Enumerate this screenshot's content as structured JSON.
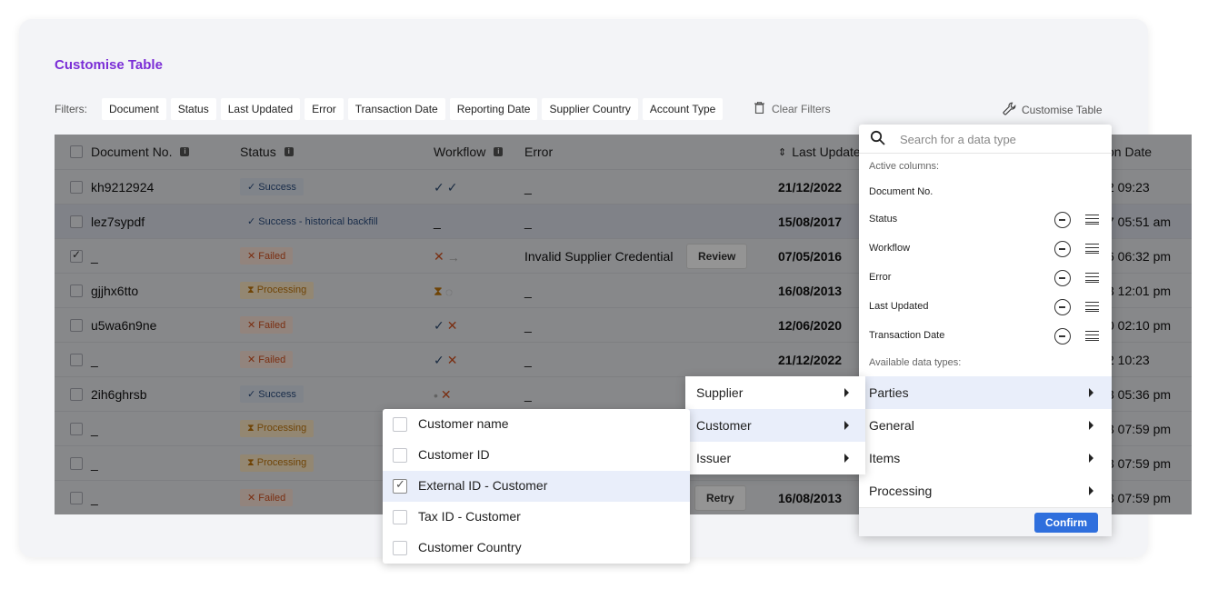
{
  "title": "Customise Table",
  "filters": {
    "label": "Filters:",
    "chips": [
      "Document",
      "Status",
      "Last Updated",
      "Error",
      "Transaction Date",
      "Reporting Date",
      "Supplier Country",
      "Account Type"
    ],
    "clear": "Clear Filters",
    "customise": "Customise Table"
  },
  "table": {
    "headers": {
      "doc": "Document No.",
      "status": "Status",
      "workflow": "Workflow",
      "error": "Error",
      "last_updated": "Last Updated",
      "transaction_date": "on Date"
    },
    "rows": [
      {
        "doc": "kh9212924",
        "status": "Success",
        "status_kind": "success",
        "workflow": "ok,ok",
        "error": "_",
        "updated": "21/12/2022",
        "tx": "2 09:23",
        "checked": false
      },
      {
        "doc": "lez7sypdf",
        "status": "Success - historical backfill",
        "status_kind": "hist",
        "workflow": "-",
        "error": "_",
        "updated": "15/08/2017",
        "tx": "7 05:51 am",
        "checked": false,
        "highlight": true
      },
      {
        "doc": "_",
        "status": "Failed",
        "status_kind": "failed",
        "workflow": "x,arrow",
        "error": "Invalid Supplier Credential",
        "action": "Review",
        "updated": "07/05/2016",
        "tx": "6 06:32 pm",
        "checked": true
      },
      {
        "doc": "gjjhx6tto",
        "status": "Processing",
        "status_kind": "processing",
        "workflow": "p,dim",
        "error": "_",
        "updated": "16/08/2013",
        "tx": "3 12:01 pm",
        "checked": false
      },
      {
        "doc": "u5wa6n9ne",
        "status": "Failed",
        "status_kind": "failed",
        "workflow": "ok,x",
        "error": "_",
        "updated": "12/06/2020",
        "tx": "0 02:10 pm",
        "checked": false
      },
      {
        "doc": "_",
        "status": "Failed",
        "status_kind": "failed",
        "workflow": "ok,x",
        "error": "_",
        "updated": "21/12/2022",
        "tx": "2 10:23",
        "checked": false
      },
      {
        "doc": "2ih6ghrsb",
        "status": "Success",
        "status_kind": "success",
        "workflow": "dot,x",
        "error": "_",
        "updated": "",
        "tx": "3 05:36 pm",
        "checked": false
      },
      {
        "doc": "_",
        "status": "Processing",
        "status_kind": "processing",
        "workflow": "",
        "error": "",
        "updated": "",
        "tx": "3 07:59 pm",
        "checked": false
      },
      {
        "doc": "_",
        "status": "Processing",
        "status_kind": "processing",
        "workflow": "",
        "error": "",
        "updated": "",
        "tx": "3 07:59 pm",
        "checked": false
      },
      {
        "doc": "_",
        "status": "Failed",
        "status_kind": "failed",
        "workflow": "",
        "error": "",
        "action": "Retry",
        "updated": "16/08/2013",
        "tx": "3 07:59 pm",
        "checked": false
      }
    ]
  },
  "panel": {
    "search_placeholder": "Search for a data type",
    "active_label": "Active columns:",
    "active_columns": [
      "Document No.",
      "Status",
      "Workflow",
      "Error",
      "Last Updated",
      "Transaction Date"
    ],
    "available_label": "Available data types:",
    "types": [
      "Parties",
      "General",
      "Items",
      "Processing"
    ],
    "confirm": "Confirm"
  },
  "parties_menu": [
    "Supplier",
    "Customer",
    "Issuer"
  ],
  "customer_menu": [
    {
      "label": "Customer name",
      "checked": false
    },
    {
      "label": "Customer ID",
      "checked": false
    },
    {
      "label": "External ID - Customer",
      "checked": true
    },
    {
      "label": "Tax ID - Customer",
      "checked": false
    },
    {
      "label": "Customer Country",
      "checked": false
    }
  ]
}
